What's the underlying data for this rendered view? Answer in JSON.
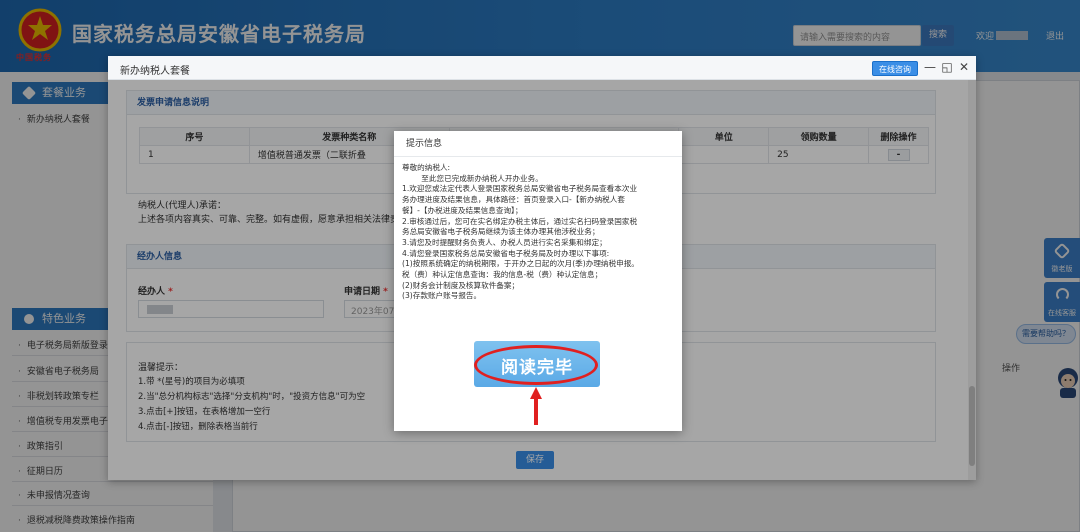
{
  "header": {
    "site_title": "国家税务总局安徽省电子税务局",
    "emblem_text": "中国税务",
    "search_placeholder": "请输入需要搜索的内容",
    "search_label": "搜索",
    "welcome": "欢迎",
    "logout": "退出"
  },
  "sidebar": {
    "section1": "套餐业务",
    "section1_items": [
      "新办纳税人套餐"
    ],
    "section2": "特色业务",
    "section2_items": [
      "电子税务局新版登录",
      "安徽省电子税务局",
      "非税划转政策专栏",
      "增值税专用发票电子",
      "政策指引",
      "征期日历",
      "未申报情况查询",
      "退税减税降费政策操作指南"
    ]
  },
  "main": {
    "operation_header": "操作"
  },
  "float_tools": {
    "old_version": "徽老版",
    "online_service": "在线客服",
    "help": "需要帮助吗？",
    "mascot": "征纳互动"
  },
  "dialog": {
    "title": "新办纳税人套餐",
    "consult": "在线咨询",
    "invoice_panel": {
      "title": "发票申请信息说明",
      "headers": [
        "序号",
        "发票种类名称",
        "单位",
        "领购数量",
        "删除操作"
      ],
      "rows": [
        {
          "no": "1",
          "name": "增值税普通发票（二联折叠",
          "unit": "",
          "qty": "25",
          "op": "-"
        }
      ]
    },
    "promise_label": "纳税人(代理人)承诺：",
    "promise_text": "上述各项内容真实、可靠、完整。如有虚假，愿意承担相关法律责",
    "agent_panel": {
      "title": "经办人信息",
      "agent_label": "经办人",
      "date_label": "申请日期",
      "date_value": "2023年07"
    },
    "tips": {
      "title": "温馨提示：",
      "lines": [
        "1.带 *(星号)的项目为必填项",
        "2.当\"总分机构标志\"选择\"分支机构\"时，\"投资方信息\"可为空",
        "3.点击[+]按钮，在表格增加一空行",
        "4.点击[-]按钮，删除表格当前行"
      ]
    },
    "save": "保存"
  },
  "prompt": {
    "title": "提示信息",
    "lines": [
      "尊敬的纳税人:",
      "        至此您已完成新办纳税人开办业务。",
      "1.欢迎您或法定代表人登录国家税务总局安徽省电子税务局查看本次业",
      "务办理进度及结果信息，具体路径：首页登录入口-【新办纳税人套",
      "餐】-【办税进度及结果信息查询】；",
      "2.审核通过后，您可在实名绑定办税主体后，通过实名扫码登录国家税",
      "务总局安徽省电子税务局继续为该主体办理其他涉税业务；",
      "3.请您及时提醒财务负责人、办税人员进行实名采集和绑定；",
      "4.请您登录国家税务总局安徽省电子税务局及时办理以下事项:",
      "(1)按照系统确定的纳税期限，于开办之日起的次月(季)办理纳税申报。",
      "税（费）种认定信息查询：我的信息-税（费）种认定信息；",
      "(2)财务会计制度及核算软件备案；",
      "(3)存款账户账号报告。"
    ],
    "read_done": "阅读完毕"
  }
}
